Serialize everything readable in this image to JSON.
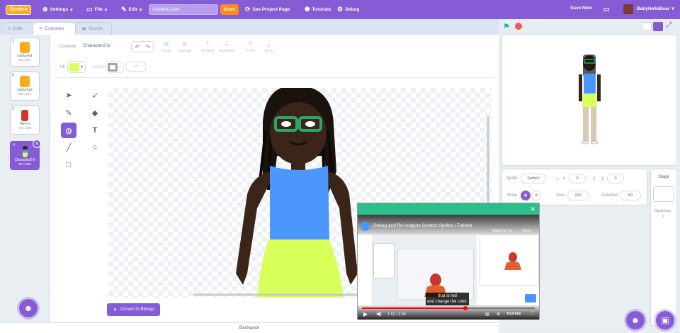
{
  "menubar": {
    "logo": "Scratch",
    "settings": "Settings",
    "file": "File",
    "edit": "Edit",
    "project_title": "Untitled-2184",
    "share": "Share",
    "see_project_page": "See Project Page",
    "tutorials": "Tutorials",
    "debug": "Debug",
    "save_now": "Save Now",
    "username": "BabyHelloBear"
  },
  "tabs": {
    "code": "Code",
    "costumes": "Costumes",
    "sounds": "Sounds"
  },
  "costumes": [
    {
      "num": "1",
      "name": "costume1",
      "size": "96 x 101"
    },
    {
      "num": "2",
      "name": "costume2",
      "size": "96 x 101"
    },
    {
      "num": "3",
      "name": "Ben-b",
      "size": "72 x 106"
    },
    {
      "num": "4",
      "name": "Character2-b",
      "size": "98 x 295"
    }
  ],
  "editor": {
    "costume_label": "Costume",
    "costume_name": "Character2-b",
    "group": "Group",
    "ungroup": "Ungroup",
    "forward": "Forward",
    "backward": "Backward",
    "front": "Front",
    "back": "Back",
    "fill_label": "Fill",
    "fill_color": "#d9ff5a",
    "outline_label": "Outline",
    "outline_width": "4",
    "convert_button": "Convert to Bitmap",
    "backpack": "Backpack"
  },
  "sprite_info": {
    "sprite_label": "Sprite",
    "sprite_name": "Sprite1",
    "x_label": "x",
    "x_value": "0",
    "y_label": "y",
    "y_value": "0",
    "show_label": "Show",
    "size_label": "Size",
    "size_value": "100",
    "direction_label": "Direction",
    "direction_value": "90"
  },
  "stage_panel": {
    "title": "Stage",
    "backdrops_label": "Backdrops",
    "backdrops_count": "1"
  },
  "video": {
    "title": "Debug and Re-imagine Scratch Sprites | Tutorial",
    "sub_label_left": "Watch on Sc...",
    "sub_label_right": "Share",
    "subtitle_line1": "that is red",
    "subtitle_line2": "and change the color.",
    "time": "1:53 / 2:35",
    "progress": 0.6
  },
  "colors": {
    "accent": "#855cd6",
    "share": "#ff8c1a",
    "video_bar": "#2bbf8a"
  }
}
